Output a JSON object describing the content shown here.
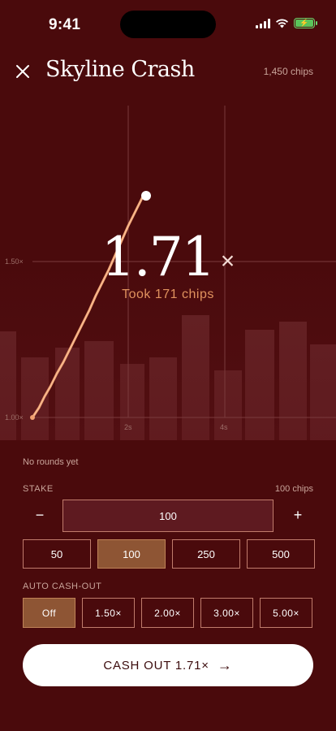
{
  "status_bar": {
    "time": "9:41"
  },
  "header": {
    "title": "Skyline Crash",
    "balance": "1,450 chips"
  },
  "round": {
    "multiplier": "1.71",
    "multiplier_suffix": "×",
    "took_message": "Took 171 chips",
    "y_labels": [
      "1.50×",
      "1.00×"
    ],
    "x_labels": [
      "2s",
      "4s"
    ]
  },
  "history": {
    "empty_text": "No rounds yet"
  },
  "stake": {
    "label": "STAKE",
    "amount_text": "100 chips",
    "value": "100",
    "minus": "−",
    "plus": "+",
    "presets": [
      "50",
      "100",
      "250",
      "500"
    ],
    "active_preset": "100"
  },
  "auto_cashout": {
    "label": "AUTO CASH-OUT",
    "options": [
      "Off",
      "1.50×",
      "2.00×",
      "3.00×",
      "5.00×"
    ],
    "active": "Off"
  },
  "cashout_button": {
    "label": "CASH OUT 1.71×",
    "arrow": "→"
  },
  "colors": {
    "background": "#4a0a0c",
    "accent": "#e0925e",
    "active_chip": "#8e5534",
    "line": "#f0a070"
  }
}
